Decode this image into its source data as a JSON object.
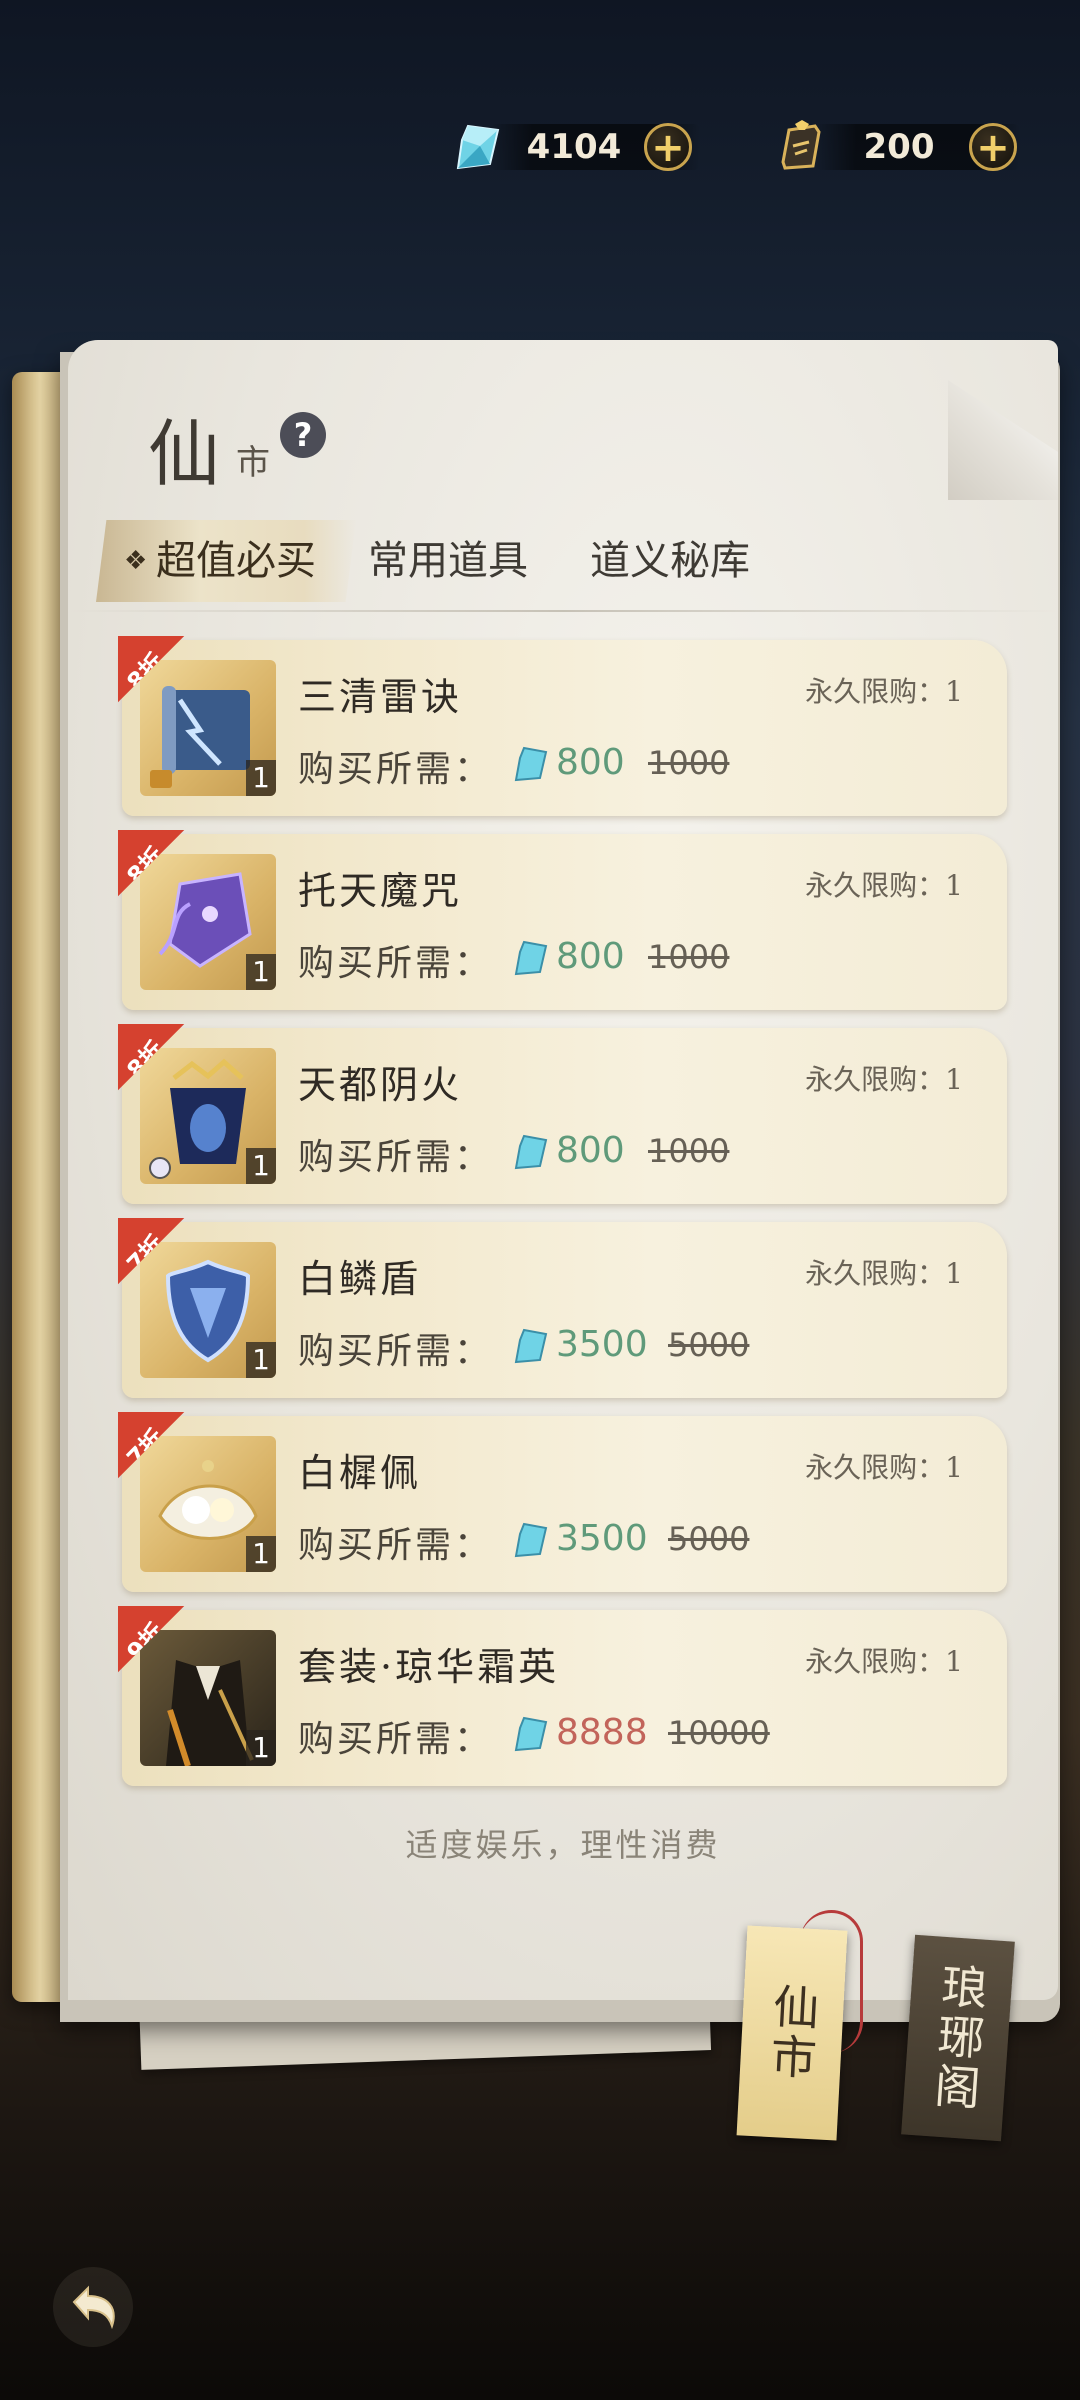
{
  "currency": {
    "gems": "4104",
    "tokens": "200",
    "plus_symbol": "+"
  },
  "shop": {
    "title_big": "仙",
    "title_small": "市",
    "help_symbol": "?",
    "tabs": [
      {
        "label": "超值必买",
        "active": true
      },
      {
        "label": "常用道具",
        "active": false
      },
      {
        "label": "道义秘库",
        "active": false
      }
    ],
    "cost_label": "购买所需：",
    "items": [
      {
        "badge": "8折",
        "name": "三清雷诀",
        "limit": "永久限购：1",
        "price": "800",
        "original": "1000",
        "qty": "1"
      },
      {
        "badge": "8折",
        "name": "托天魔咒",
        "limit": "永久限购：1",
        "price": "800",
        "original": "1000",
        "qty": "1"
      },
      {
        "badge": "8折",
        "name": "天都阴火",
        "limit": "永久限购：1",
        "price": "800",
        "original": "1000",
        "qty": "1"
      },
      {
        "badge": "7折",
        "name": "白鳞盾",
        "limit": "永久限购：1",
        "price": "3500",
        "original": "5000",
        "qty": "1"
      },
      {
        "badge": "7折",
        "name": "白樨佩",
        "limit": "永久限购：1",
        "price": "3500",
        "original": "5000",
        "qty": "1"
      },
      {
        "badge": "9折",
        "name": "套装·琼华霜英",
        "limit": "永久限购：1",
        "price": "8888",
        "original": "10000",
        "qty": "1"
      }
    ],
    "disclaimer": "适度娱乐，理性消费"
  },
  "bookmarks": {
    "xian_shi": "仙市",
    "lang_ya_ge": "琅琊阁"
  },
  "colors": {
    "price_green": "#5f9a7a",
    "price_red": "#c2645a",
    "badge_red": "#d5412f",
    "gold": "#c9a44e"
  }
}
